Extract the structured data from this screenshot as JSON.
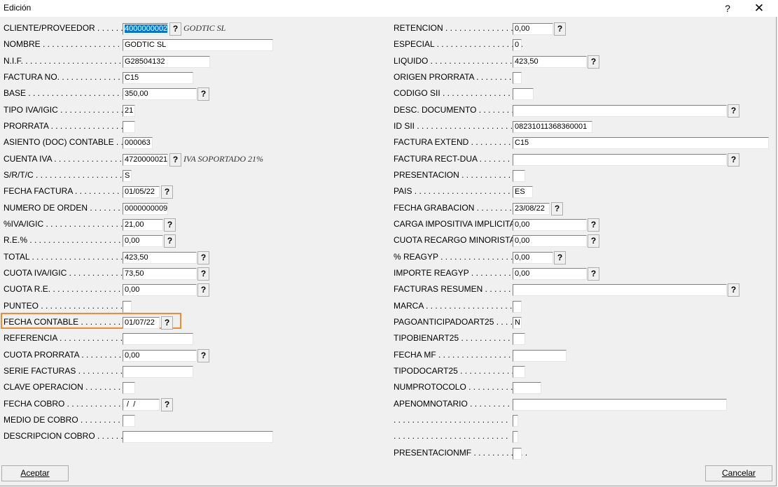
{
  "window": {
    "title": "Edición",
    "help_label": "?",
    "close_label": "✕"
  },
  "left": {
    "cliente_label": "CLIENTE/PROVEEDOR . . . . . . .",
    "cliente_value": "4000000002",
    "cliente_desc": "GODTIC SL",
    "nombre_label": "NOMBRE . . . . . . . . . . . . . . . . . . .",
    "nombre_value": "GODTIC SL",
    "nif_label": "N.I.F. . . . . . . . . . . . . . . . . . . . . .",
    "nif_value": "G28504132",
    "factura_label": "FACTURA NO. . . . . . . . . . . . . . . .",
    "factura_value": "C15",
    "base_label": "BASE . . . . . . . . . . . . . . . . . . . . .",
    "base_value": "350,00",
    "tipoiva_label": "TIPO IVA/IGIC . . . . . . . . . . . . . .",
    "tipoiva_value": "21",
    "prorrata_label": "PRORRATA . . . . . . . . . . . . . . . . .",
    "prorrata_value": "",
    "asiento_label": "ASIENTO (DOC) CONTABLE . . . .",
    "asiento_value": "000063",
    "cuentaiva_label": "CUENTA IVA . . . . . . . . . . . . . . . .",
    "cuentaiva_value": "4720000021",
    "cuentaiva_desc": "IVA SOPORTADO 21%",
    "srtc_label": "S/R/T/C . . . . . . . . . . . . . . . . . . .",
    "srtc_value": "S",
    "fechafactura_label": "FECHA FACTURA . . . . . . . . . . . . .",
    "fechafactura_value": "01/05/22",
    "numorden_label": "NUMERO DE ORDEN . . . . . . . . .",
    "numorden_value": "0000000009",
    "pctiva_label": "%IVA/IGIC . . . . . . . . . . . . . . . . .",
    "pctiva_value": "21,00",
    "re_label": "R.E.% . . . . . . . . . . . . . . . . . . . .",
    "re_value": "0,00",
    "total_label": "TOTAL . . . . . . . . . . . . . . . . . . . .",
    "total_value": "423,50",
    "cuotaiva_label": "CUOTA IVA/IGIC . . . . . . . . . . . .",
    "cuotaiva_value": "73,50",
    "cuotare_label": "CUOTA R.E. . . . . . . . . . . . . . . . .",
    "cuotare_value": "0,00",
    "punteo_label": "PUNTEO . . . . . . . . . . . . . . . . . . .",
    "punteo_value": "",
    "fechacontable_label": "FECHA CONTABLE . . . . . . . . . . . .",
    "fechacontable_value": "01/07/22",
    "referencia_label": "REFERENCIA . . . . . . . . . . . . . . .",
    "referencia_value": "",
    "cuotaprorrata_label": "CUOTA PRORRATA . . . . . . . . . . .",
    "cuotaprorrata_value": "0,00",
    "seriefacturas_label": "SERIE FACTURAS . . . . . . . . . . . .",
    "seriefacturas_value": "",
    "claveop_label": "CLAVE OPERACION . . . . . . . . . .",
    "claveop_value": "",
    "fechacobro_label": "FECHA COBRO . . . . . . . . . . . . . .",
    "fechacobro_value": " /  /",
    "mediocobro_label": "MEDIO DE COBRO . . . . . . . . . . . .",
    "mediocobro_value": "",
    "desccobro_label": "DESCRIPCION COBRO . . . . . . . .",
    "desccobro_value": ""
  },
  "right": {
    "retencion_label": "RETENCION . . . . . . . . . . . . . . . . . .",
    "retencion_value": "0,00",
    "especial_label": "ESPECIAL . . . . . . . . . . . . . . . . . . .",
    "especial_value": "0",
    "liquido_label": "LIQUIDO . . . . . . . . . . . . . . . . . . . .",
    "liquido_value": "423,50",
    "origen_label": "ORIGEN PRORRATA . . . . . . . . . .",
    "origen_value": "",
    "codigosii_label": "CODIGO SII . . . . . . . . . . . . . . . . .",
    "codigosii_value": "",
    "descdoc_label": "DESC. DOCUMENTO . . . . . . . . . .",
    "descdoc_value": "",
    "idsii_label": "ID SII . . . . . . . . . . . . . . . . . . . . .",
    "idsii_value": "08231011368360001",
    "factextend_label": "FACTURA EXTEND . . . . . . . . . . . .",
    "factextend_value": "C15",
    "factrect_label": "FACTURA RECT-DUA . . . . . . . . . .",
    "factrect_value": "",
    "presentacion_label": "PRESENTACION . . . . . . . . . . . . . .",
    "presentacion_value": "",
    "pais_label": "PAIS . . . . . . . . . . . . . . . . . . . . . .",
    "pais_value": "ES",
    "fechagrab_label": "FECHA GRABACION . . . . . . . . . . .",
    "fechagrab_value": "23/08/22",
    "carga_label": "CARGA IMPOSITIVA IMPLICITA . .",
    "carga_value": "0,00",
    "cuotarecargo_label": "CUOTA RECARGO MINORISTA .",
    "cuotarecargo_value": "0,00",
    "reagyp_label": "% REAGYP . . . . . . . . . . . . . . . . . .",
    "reagyp_value": "0,00",
    "importereagyp_label": "IMPORTE REAGYP . . . . . . . . . . .",
    "importereagyp_value": "0,00",
    "factresumen_label": "FACTURAS RESUMEN . . . . . . . .",
    "factresumen_value": "",
    "marca_label": "MARCA . . . . . . . . . . . . . . . . . . . . .",
    "marca_value": "",
    "pago_label": "PAGOANTICIPADOART25 . . . . .",
    "pago_value": "N",
    "tipobien_label": "TIPOBIENART25 . . . . . . . . . . . . . .",
    "tipobien_value": "",
    "fechamf_label": "FECHA MF . . . . . . . . . . . . . . . . .",
    "fechamf_value": "",
    "tipodoc_label": "TIPODOCART25 . . . . . . . . . . . . . .",
    "tipodoc_value": "",
    "numprot_label": "NUMPROTOCOLO . . . . . . . . . . . . .",
    "numprot_value": "",
    "apenom_label": "APENOMNOTARIO . . . . . . . . . . . .",
    "apenom_value": "",
    "blank1_label": ". . . . . . . . . . . . . . . . . . . . . . . . .",
    "blank1_value": "",
    "blank2_label": ". . . . . . . . . . . . . . . . . . . . . . . . .",
    "blank2_value": "",
    "presmf_label": "PRESENTACIONMF . . . . . . . . . . . .",
    "presmf_value": ""
  },
  "lookup_button_label": "?",
  "buttons": {
    "accept_label": "Aceptar",
    "cancel_label": "Cancelar"
  },
  "colors": {
    "highlight": "#f28a30",
    "selection": "#0078d7"
  }
}
